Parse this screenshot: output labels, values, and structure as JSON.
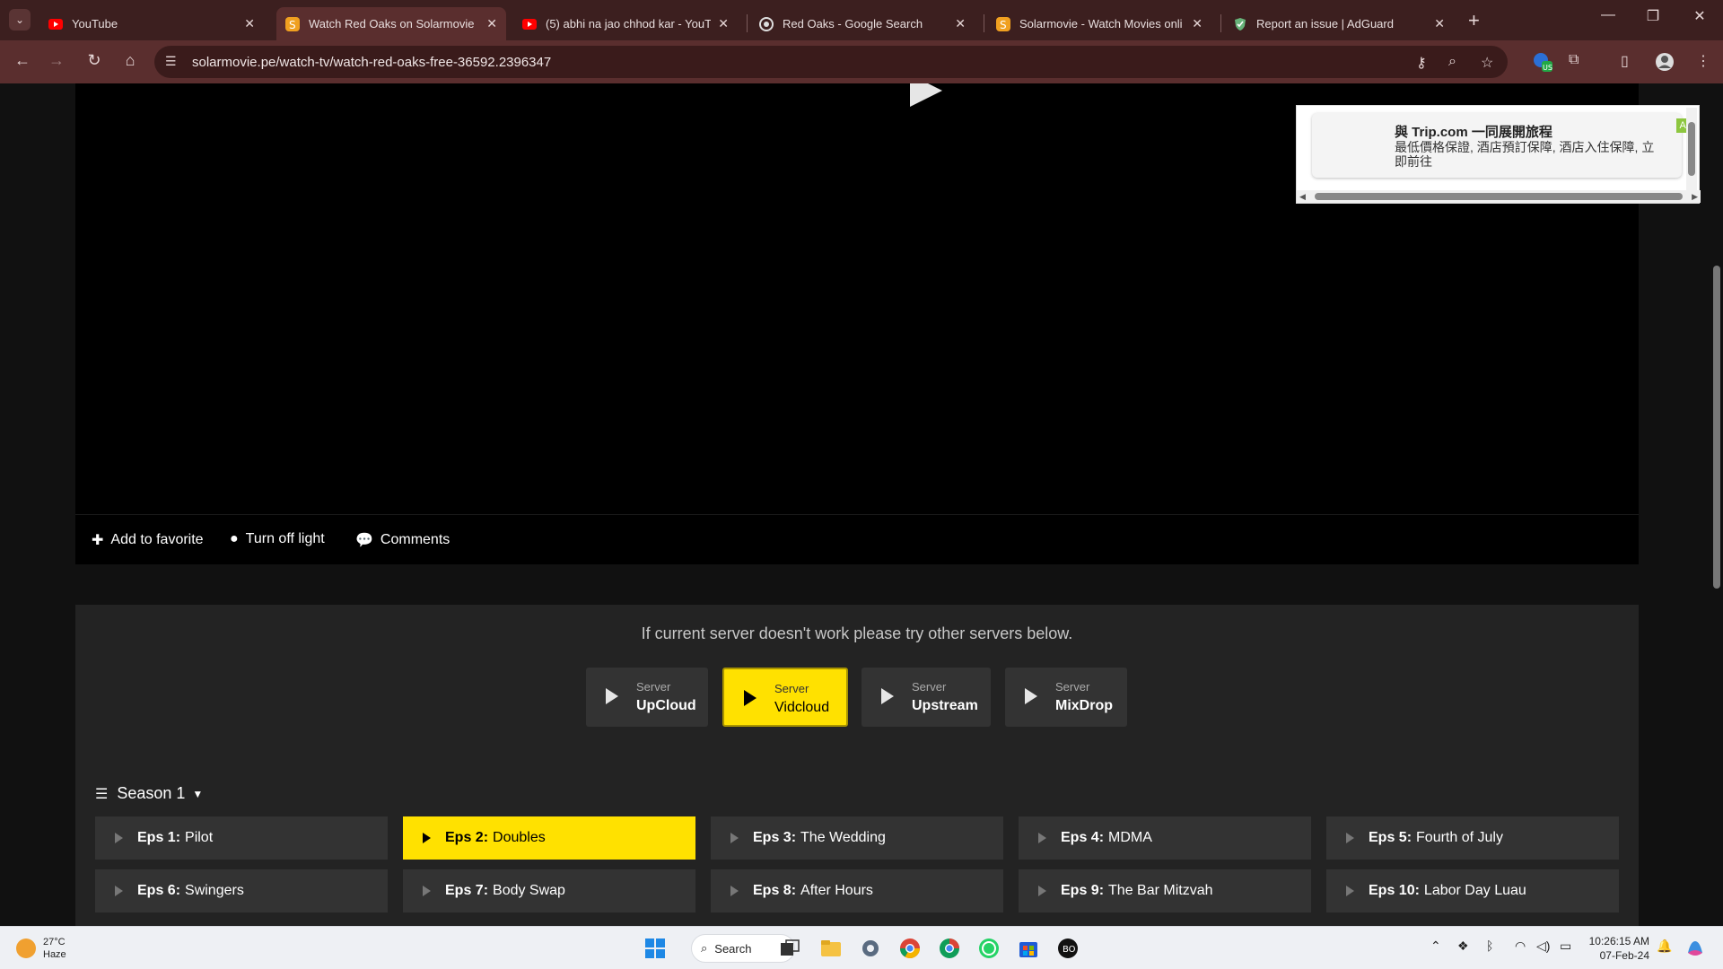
{
  "browser": {
    "tabs": [
      {
        "title": "YouTube",
        "icon": "youtube-icon",
        "active": false
      },
      {
        "title": "Watch Red Oaks on Solarmovie",
        "icon": "solarmovie-icon",
        "active": true
      },
      {
        "title": "(5) abhi na jao chhod kar - YouT",
        "icon": "youtube-icon",
        "active": false
      },
      {
        "title": "Red Oaks - Google Search",
        "icon": "google-icon",
        "active": false
      },
      {
        "title": "Solarmovie - Watch Movies onli",
        "icon": "solarmovie-icon",
        "active": false
      },
      {
        "title": "Report an issue | AdGuard",
        "icon": "adguard-icon",
        "active": false
      }
    ],
    "url": "solarmovie.pe/watch-tv/watch-red-oaks-free-36592.2396347",
    "colors": {
      "tabbar": "#3c1f1f",
      "toolbar": "#5a2e2e"
    }
  },
  "player": {
    "actions": {
      "favorite": "Add to favorite",
      "light": "Turn off light",
      "comments": "Comments"
    }
  },
  "ad": {
    "title": "與 Trip.com 一同展開旅程",
    "text": "最低價格保證, 酒店預訂保障, 酒店入住保障, 立即前往",
    "badge": "Ad"
  },
  "servers": {
    "message": "If current server doesn't work please try other servers below.",
    "label": "Server",
    "list": [
      {
        "name": "UpCloud",
        "active": false
      },
      {
        "name": "Vidcloud",
        "active": true
      },
      {
        "name": "Upstream",
        "active": false
      },
      {
        "name": "MixDrop",
        "active": false
      }
    ],
    "accent": "#ffe100"
  },
  "season": {
    "label": "Season 1"
  },
  "episodes": [
    {
      "num": "Eps 1:",
      "title": "Pilot",
      "active": false
    },
    {
      "num": "Eps 2:",
      "title": "Doubles",
      "active": true
    },
    {
      "num": "Eps 3:",
      "title": "The Wedding",
      "active": false
    },
    {
      "num": "Eps 4:",
      "title": "MDMA",
      "active": false
    },
    {
      "num": "Eps 5:",
      "title": "Fourth of July",
      "active": false
    },
    {
      "num": "Eps 6:",
      "title": "Swingers",
      "active": false
    },
    {
      "num": "Eps 7:",
      "title": "Body Swap",
      "active": false
    },
    {
      "num": "Eps 8:",
      "title": "After Hours",
      "active": false
    },
    {
      "num": "Eps 9:",
      "title": "The Bar Mitzvah",
      "active": false
    },
    {
      "num": "Eps 10:",
      "title": "Labor Day Luau",
      "active": false
    }
  ],
  "taskbar": {
    "weather_temp": "27°C",
    "weather_desc": "Haze",
    "search_label": "Search",
    "time": "10:26:15 AM",
    "date": "07-Feb-24"
  }
}
